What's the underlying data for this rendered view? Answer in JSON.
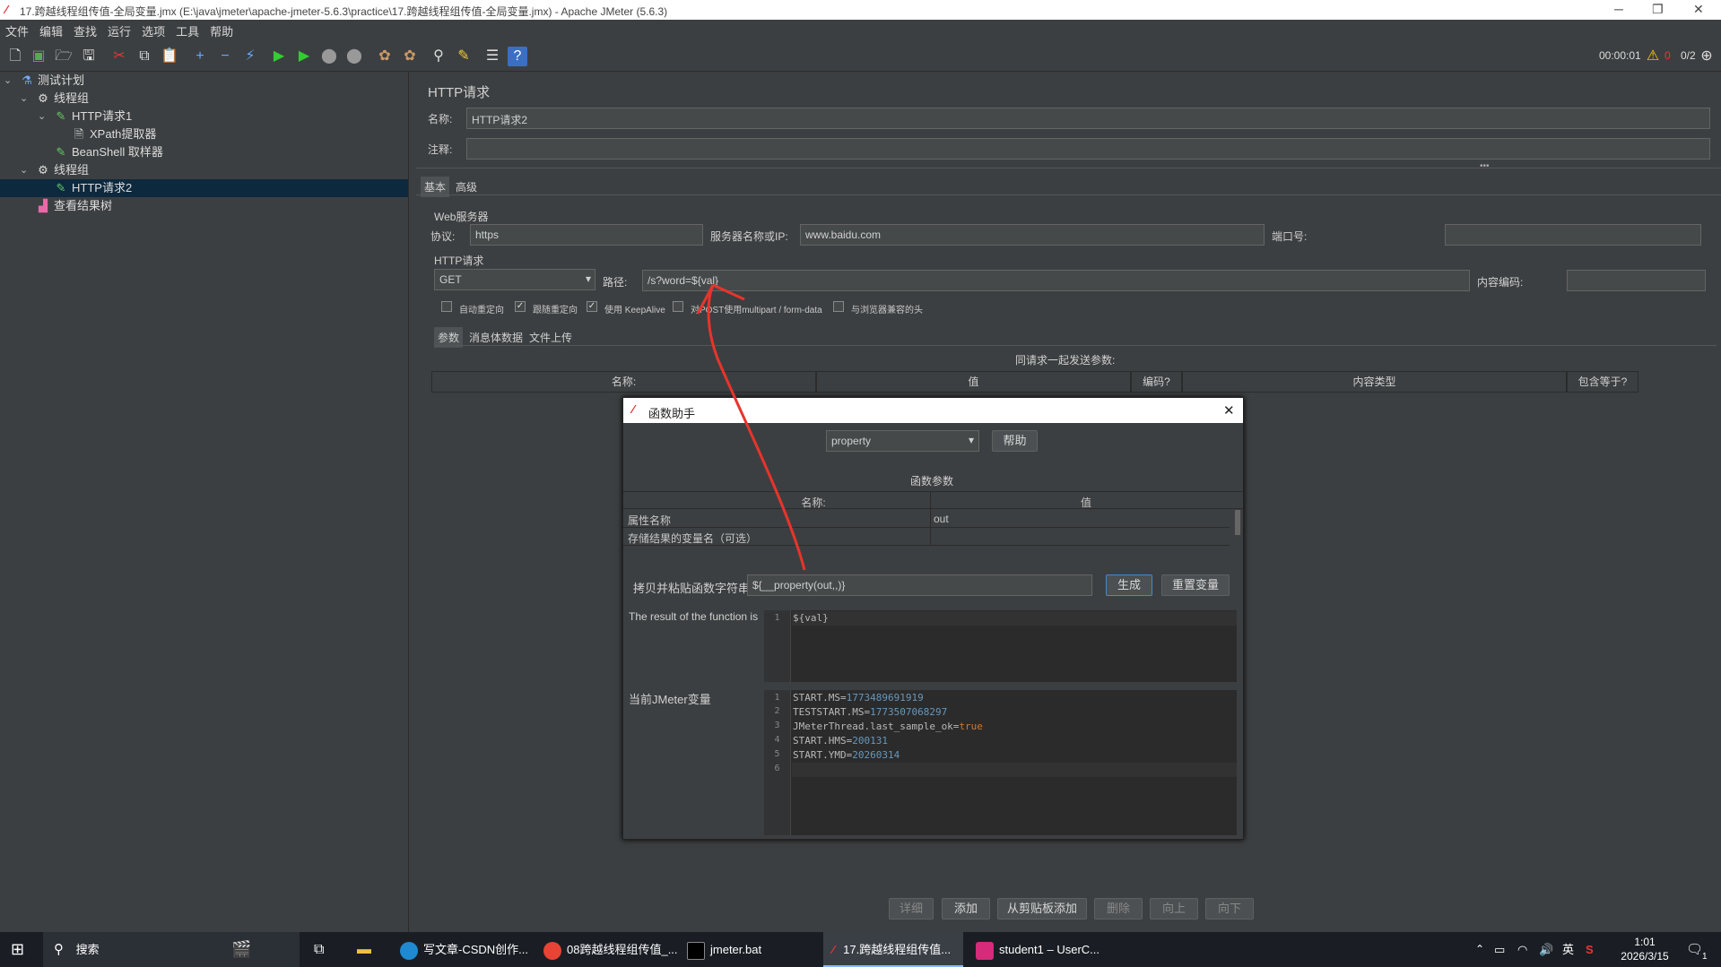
{
  "window": {
    "title": "17.跨越线程组传值-全局变量.jmx (E:\\java\\jmeter\\apache-jmeter-5.6.3\\practice\\17.跨越线程组传值-全局变量.jmx) - Apache JMeter (5.6.3)"
  },
  "menu": [
    "文件",
    "编辑",
    "查找",
    "运行",
    "选项",
    "工具",
    "帮助"
  ],
  "toolbar": {
    "timer": "00:00:01",
    "warning_count": "0",
    "thread_count": "0/2"
  },
  "tree": {
    "test_plan": "测试计划",
    "thread_group_1": "线程组",
    "http_request_1": "HTTP请求1",
    "xpath_extractor": "XPath提取器",
    "beanshell_sampler": "BeanShell 取样器",
    "thread_group_2": "线程组",
    "http_request_2": "HTTP请求2",
    "results_tree": "查看结果树"
  },
  "main": {
    "heading": "HTTP请求",
    "name_label": "名称:",
    "name_value": "HTTP请求2",
    "comment_label": "注释:",
    "comment_value": "",
    "tabs": [
      "基本",
      "高级"
    ],
    "web_server_legend": "Web服务器",
    "protocol_label": "协议:",
    "protocol_value": "https",
    "server_label": "服务器名称或IP:",
    "server_value": "www.baidu.com",
    "port_label": "端口号:",
    "port_value": "",
    "http_request_legend": "HTTP请求",
    "method_value": "GET",
    "path_label": "路径:",
    "path_value": "/s?word=${val}",
    "encoding_label": "内容编码:",
    "encoding_value": "",
    "checkboxes": [
      {
        "label": "自动重定向",
        "checked": false
      },
      {
        "label": "跟随重定向",
        "checked": true
      },
      {
        "label": "使用 KeepAlive",
        "checked": true
      },
      {
        "label": "对POST使用multipart / form-data",
        "checked": false
      },
      {
        "label": "与浏览器兼容的头",
        "checked": false
      }
    ],
    "param_tabs": [
      "参数",
      "消息体数据",
      "文件上传"
    ],
    "params_caption": "同请求一起发送参数:",
    "params_columns": [
      "名称:",
      "值",
      "编码?",
      "内容类型",
      "包含等于?"
    ],
    "buttons": {
      "detail": "详细",
      "add": "添加",
      "add_clipboard": "从剪贴板添加",
      "delete": "删除",
      "up": "向上",
      "down": "向下"
    }
  },
  "dialog": {
    "title": "函数助手",
    "function_value": "property",
    "help_button": "帮助",
    "params_title": "函数参数",
    "columns": [
      "名称:",
      "值"
    ],
    "rows": [
      {
        "name": "属性名称",
        "value": "out"
      },
      {
        "name": "存储结果的变量名（可选）",
        "value": ""
      }
    ],
    "copy_label": "拷贝并粘贴函数字符串",
    "function_string": "${__property(out,,)}",
    "generate_button": "生成",
    "reset_button": "重置变量",
    "result_label": "The result of the function is",
    "result_lines": [
      "${val}"
    ],
    "vars_label": "当前JMeter变量",
    "var_lines": [
      {
        "key": "START.MS=",
        "value": "1773489691919"
      },
      {
        "key": "TESTSTART.MS=",
        "value": "1773507068297"
      },
      {
        "key": "JMeterThread.last_sample_ok=",
        "value": "true"
      },
      {
        "key": "START.HMS=",
        "value": "200131"
      },
      {
        "key": "START.YMD=",
        "value": "20260314"
      },
      {
        "key": "",
        "value": ""
      }
    ]
  },
  "taskbar": {
    "search": "搜索",
    "apps": [
      {
        "label": "写文章-CSDN创作..."
      },
      {
        "label": "08跨越线程组传值_..."
      },
      {
        "label": "jmeter.bat"
      },
      {
        "label": "17.跨越线程组传值..."
      },
      {
        "label": "student1 – UserC..."
      }
    ],
    "ime": "英",
    "time": "1:01",
    "date": "2026/3/15",
    "notification_count": "1"
  },
  "colors": {
    "accent": "#0d293e",
    "annotation": "#e8342c"
  }
}
